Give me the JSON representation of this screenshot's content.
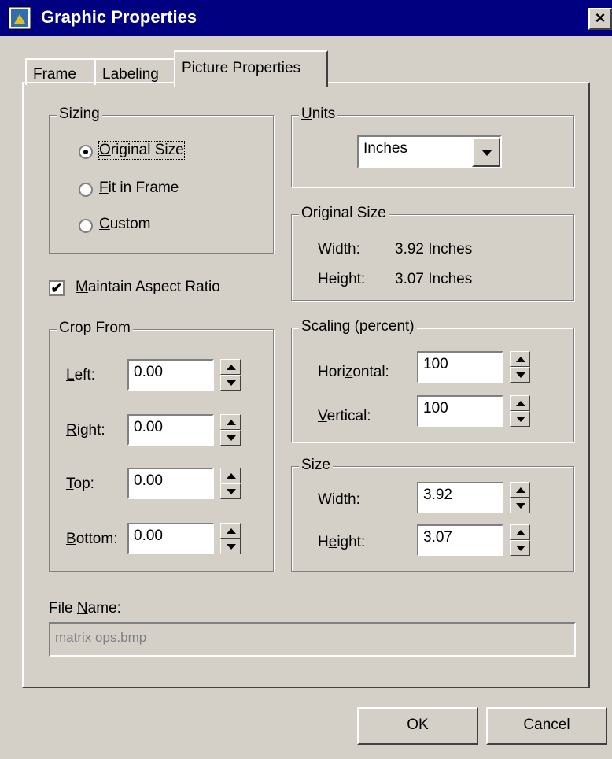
{
  "window": {
    "title": "Graphic Properties",
    "close_glyph": "×"
  },
  "tabs": [
    {
      "label": "Frame",
      "active": false
    },
    {
      "label": "Labeling",
      "active": false
    },
    {
      "label": "Picture Properties",
      "active": true
    }
  ],
  "sizing": {
    "title": "Sizing",
    "options": [
      {
        "mn": "O",
        "rest": "riginal Size",
        "selected": true
      },
      {
        "mn": "F",
        "rest": "it in Frame",
        "selected": false
      },
      {
        "mn": "C",
        "rest": "ustom",
        "selected": false
      }
    ]
  },
  "maintain_aspect": {
    "mn": "M",
    "rest": "aintain Aspect Ratio",
    "checked": true,
    "check_glyph": "✔"
  },
  "crop": {
    "title": "Crop From",
    "fields": [
      {
        "mn": "L",
        "rest": "eft:",
        "value": "0.00"
      },
      {
        "mn": "R",
        "rest": "ight:",
        "value": "0.00"
      },
      {
        "mn": "T",
        "rest": "op:",
        "value": "0.00"
      },
      {
        "mn": "B",
        "rest": "ottom:",
        "value": "0.00"
      }
    ]
  },
  "units": {
    "title_mn": "U",
    "title_rest": "nits",
    "selected": "Inches"
  },
  "original_size": {
    "title": "Original Size",
    "width_label": "Width:",
    "width_value": "3.92 Inches",
    "height_label": "Height:",
    "height_value": "3.07 Inches"
  },
  "scaling": {
    "title": "Scaling (percent)",
    "horizontal": {
      "pre": "Hori",
      "mn": "z",
      "post": "ontal:",
      "value": "100"
    },
    "vertical": {
      "pre": "",
      "mn": "V",
      "post": "ertical:",
      "value": "100"
    }
  },
  "size": {
    "title": "Size",
    "width": {
      "pre": "Wi",
      "mn": "d",
      "post": "th:",
      "value": "3.92"
    },
    "height": {
      "pre": "H",
      "mn": "e",
      "post": "ight:",
      "value": "3.07"
    }
  },
  "file_name": {
    "label_pre": "File ",
    "label_mn": "N",
    "label_post": "ame:",
    "value": "matrix ops.bmp"
  },
  "buttons": {
    "ok": "OK",
    "cancel": "Cancel"
  },
  "colors": {
    "title_bar": "#000080",
    "face": "#d4d0c8",
    "disabled_text": "#808080"
  }
}
